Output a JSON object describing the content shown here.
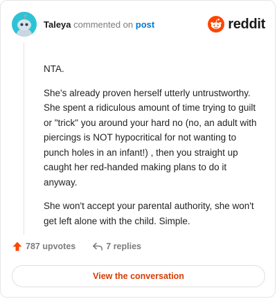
{
  "header": {
    "author": "Taleya",
    "commented_text": "commented on",
    "post_link": "post",
    "brand": "reddit",
    "avatar_color": "#2cc3d6",
    "brand_color": "#ff4500"
  },
  "comment": {
    "paragraphs": [
      "NTA.",
      "She's already proven herself utterly untrustworthy. She spent a ridiculous amount of time trying to guilt or \"trick\" you around your hard no (no, an adult with piercings is NOT hypocritical for not wanting to punch holes in an infant!) , then you straight up caught her red-handed making plans to do it anyway.",
      "She won't accept your parental authority, she won't get left alone with the child. Simple."
    ]
  },
  "actions": {
    "upvotes": "787 upvotes",
    "replies": "7 replies",
    "upvote_icon": "upvote-arrow-icon",
    "reply_icon": "reply-arrow-icon",
    "upvote_color": "#ff4500"
  },
  "footer": {
    "view_label": "View the conversation",
    "view_color": "#d93a00"
  }
}
